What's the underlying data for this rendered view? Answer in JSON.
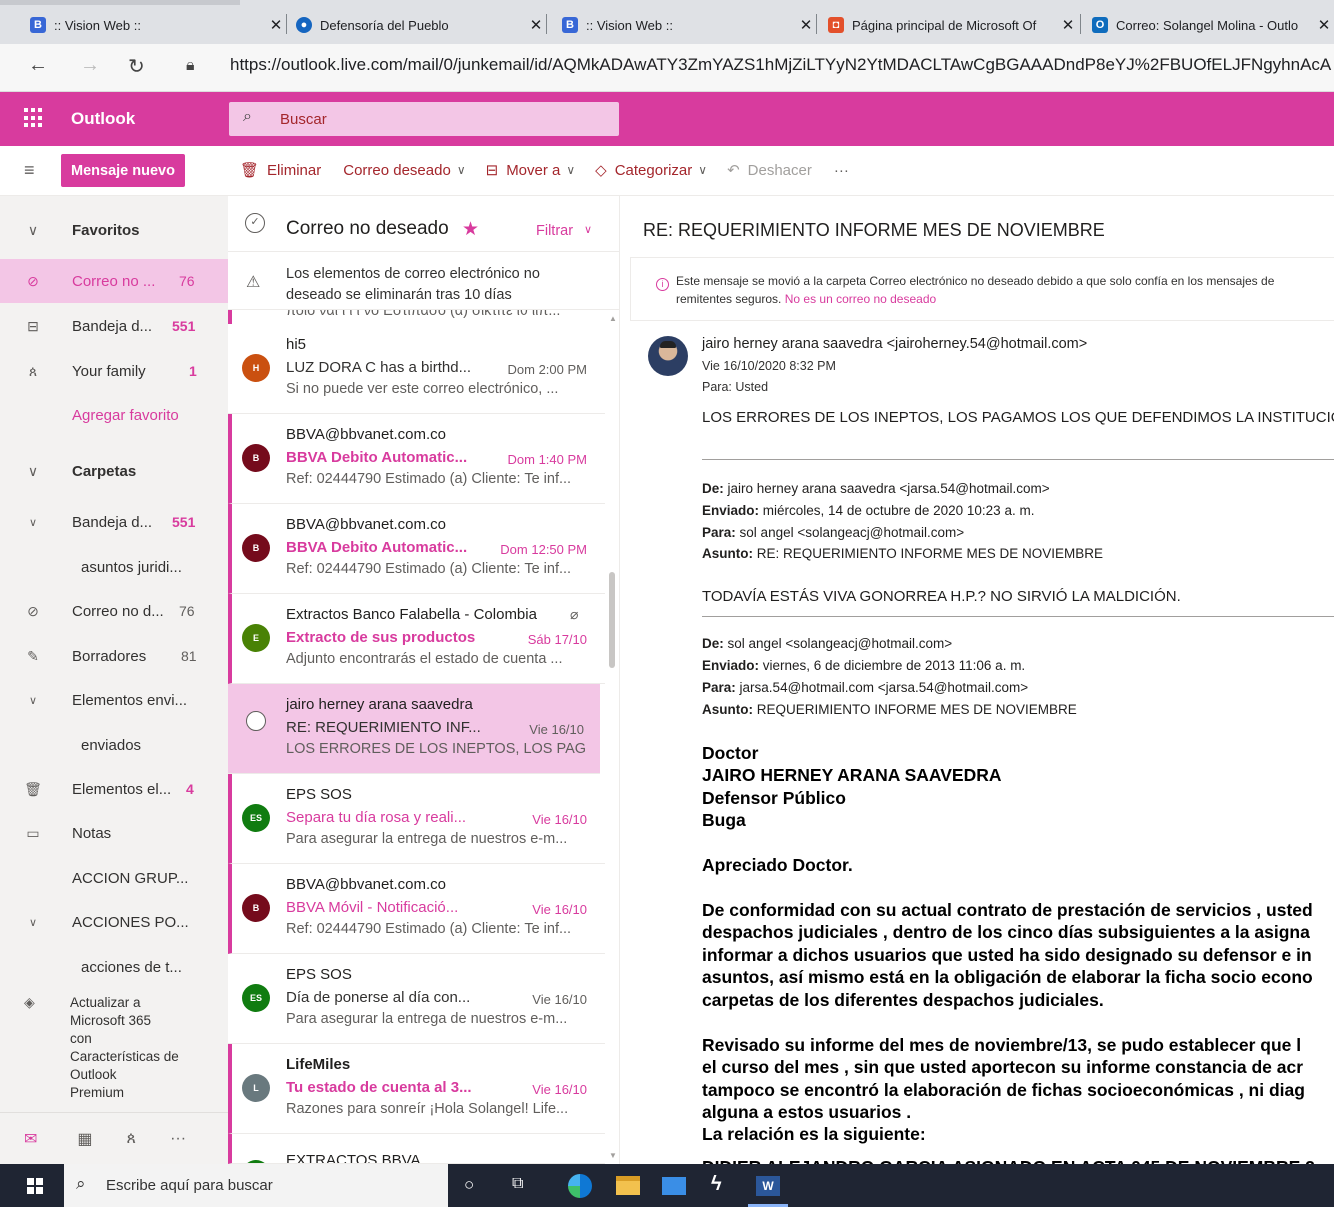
{
  "browser": {
    "tabs": [
      {
        "title": ":: Vision Web ::",
        "icon": "b-icon",
        "color": "#3867d6"
      },
      {
        "title": "Defensoría del Pueblo",
        "icon": "defensoria-icon",
        "color": "#1565c0"
      },
      {
        "title": ":: Vision Web ::",
        "icon": "b-icon",
        "color": "#3867d6"
      },
      {
        "title": "Página principal de Microsoft Of",
        "icon": "office-icon",
        "color": "#e3502b"
      },
      {
        "title": "Correo: Solangel Molina - Outlo",
        "icon": "outlook-icon",
        "color": "#0f6cbd"
      }
    ],
    "url": "https://outlook.live.com/mail/0/junkemail/id/AQMkADAwATY3ZmYAZS1hMjZiLTYyN2YtMDACLTAwCgBGAAADndP8eYJ%2FBUOfELJFNgyhnAcA"
  },
  "app": {
    "name": "Outlook",
    "search_placeholder": "Buscar",
    "brand_color": "#d83b9e"
  },
  "toolbar": {
    "new_message": "Mensaje nuevo",
    "delete": "Eliminar",
    "junk": "Correo deseado",
    "move": "Mover a",
    "categorize": "Categorizar",
    "undo": "Deshacer",
    "more": "···"
  },
  "nav": {
    "favorites_header": "Favoritos",
    "favorites": [
      {
        "label": "Correo no ...",
        "count": "76",
        "icon": "blocked-icon"
      },
      {
        "label": "Bandeja d...",
        "count": "551",
        "icon": "inbox-icon"
      },
      {
        "label": "Your family",
        "count": "1",
        "icon": "people-icon"
      }
    ],
    "add_favorite": "Agregar favorito",
    "folders_header": "Carpetas",
    "folders": [
      {
        "label": "Bandeja d...",
        "count": "551"
      },
      {
        "label": "asuntos juridi...",
        "count": ""
      },
      {
        "label": "Correo no d...",
        "count": "76"
      },
      {
        "label": "Borradores",
        "count": "81"
      },
      {
        "label": "Elementos envi...",
        "count": ""
      },
      {
        "label": "enviados",
        "count": ""
      },
      {
        "label": "Elementos el...",
        "count": "4"
      },
      {
        "label": "Notas",
        "count": ""
      },
      {
        "label": "ACCION GRUP...",
        "count": ""
      },
      {
        "label": "ACCIONES PO...",
        "count": ""
      },
      {
        "label": "acciones de t...",
        "count": ""
      }
    ],
    "upgrade": [
      "Actualizar a",
      "Microsoft 365",
      "con",
      "Características de",
      "Outlook",
      "Premium"
    ]
  },
  "list": {
    "title": "Correo no deseado",
    "filter": "Filtrar",
    "notice": [
      "Los elementos de correo electrónico no",
      "deseado se eliminarán tras 10 días"
    ],
    "partial_top": "ποιο ναι ι ι ι νο Εστιπασο (α) σικτίτε ιθ ιιπ...",
    "messages": [
      {
        "initial": "H",
        "avatar_color": "#ca5010",
        "from": "hi5",
        "subject": "LUZ DORA C has a birthd...",
        "date": "Dom 2:00 PM",
        "preview": "Si no puede ver este correo electrónico, ...",
        "unread": false
      },
      {
        "initial": "B",
        "avatar_color": "#750b1c",
        "from": "BBVA@bbvanet.com.co",
        "subject": "BBVA Debito Automatic...",
        "date": "Dom 1:40 PM",
        "preview": "Ref: 02444790 Estimado (a) Cliente: Te inf...",
        "unread": true
      },
      {
        "initial": "B",
        "avatar_color": "#750b1c",
        "from": "BBVA@bbvanet.com.co",
        "subject": "BBVA Debito Automatic...",
        "date": "Dom 12:50 PM",
        "preview": "Ref: 02444790 Estimado (a) Cliente: Te inf...",
        "unread": true
      },
      {
        "initial": "E",
        "avatar_color": "#498205",
        "from": "Extractos Banco Falabella - Colombia",
        "subject": "Extracto de sus productos",
        "date": "Sáb 17/10",
        "preview": "Adjunto encontrarás el estado de cuenta ...",
        "unread": true
      },
      {
        "initial": "",
        "avatar_color": "",
        "from": "jairo herney arana saavedra",
        "subject": "RE: REQUERIMIENTO INF...",
        "date": "Vie 16/10",
        "preview": "LOS ERRORES DE LOS INEPTOS, LOS PAG...",
        "unread": false
      },
      {
        "initial": "ES",
        "avatar_color": "#107c10",
        "from": "EPS SOS",
        "subject": "Separa tu día rosa y reali...",
        "date": "Vie 16/10",
        "preview": "Para asegurar la entrega de nuestros e-m...",
        "unread": true
      },
      {
        "initial": "B",
        "avatar_color": "#750b1c",
        "from": "BBVA@bbvanet.com.co",
        "subject": "BBVA Móvil - Notificació...",
        "date": "Vie 16/10",
        "preview": "Ref: 02444790 Estimado (a) Cliente: Te inf...",
        "unread": true
      },
      {
        "initial": "ES",
        "avatar_color": "#107c10",
        "from": "EPS SOS",
        "subject": "Día de ponerse al día con...",
        "date": "Vie 16/10",
        "preview": "Para asegurar la entrega de nuestros e-m...",
        "unread": false
      },
      {
        "initial": "L",
        "avatar_color": "#69797e",
        "from": "LifeMiles",
        "subject": "Tu estado de cuenta al 3...",
        "date": "Vie 16/10",
        "preview": "Razones para sonreír ¡Hola Solangel! Life...",
        "unread": true
      },
      {
        "initial": "",
        "avatar_color": "#107c10",
        "from": "EXTRACTOS BBVA",
        "subject": "",
        "date": "",
        "preview": "",
        "unread": true
      }
    ]
  },
  "reading": {
    "subject": "RE: REQUERIMIENTO INFORME MES DE NOVIEMBRE",
    "junk_notice": "Este mensaje se movió a la carpeta Correo electrónico no deseado debido a que solo confía en los mensajes de",
    "junk_notice2": "remitentes seguros.",
    "not_junk": "No es un correo no deseado",
    "sender": "jairo herney arana saavedra <jairoherney.54@hotmail.com>",
    "sent": "Vie 16/10/2020 8:32 PM",
    "to_label": "Para:",
    "to": "Usted",
    "line1": "LOS ERRORES DE LOS INEPTOS,  LOS PAGAMOS LOS QUE DEFENDIMOS LA INSTITUCIÓN.",
    "q1": {
      "de_l": "De:",
      "de": "jairo herney arana saavedra <jarsa.54@hotmail.com>",
      "env_l": "Enviado:",
      "env": "miércoles, 14 de octubre de 2020 10:23 a. m.",
      "para_l": "Para:",
      "para": "sol angel <solangeacj@hotmail.com>",
      "asu_l": "Asunto:",
      "asu": "RE: REQUERIMIENTO INFORME MES DE NOVIEMBRE"
    },
    "line2": "TODAVÍA ESTÁS VIVA GONORREA H.P.? NO SIRVIÓ LA MALDICIÓN.",
    "q2": {
      "de_l": "De:",
      "de": "sol angel <solangeacj@hotmail.com>",
      "env_l": "Enviado:",
      "env": "viernes, 6 de diciembre de 2013 11:06 a. m.",
      "para_l": "Para:",
      "para": "jarsa.54@hotmail.com <jarsa.54@hotmail.com>",
      "asu_l": "Asunto:",
      "asu": "REQUERIMIENTO INFORME MES DE NOVIEMBRE"
    },
    "salutation": [
      "Doctor",
      "JAIRO HERNEY ARANA SAAVEDRA",
      "Defensor Público",
      "Buga"
    ],
    "greeting": "Apreciado Doctor.",
    "para1": [
      "De conformidad con su actual contrato de prestación de servicios , usted",
      "despachos judiciales , dentro de los cinco días subsiguientes a la asigna",
      "informar a dichos usuarios que usted ha sido designado su defensor e in",
      "asuntos, así mismo está en la obligación de elaborar la ficha socio econo",
      "carpetas de los diferentes despachos judiciales."
    ],
    "para2": [
      "Revisado su informe del mes de noviembre/13, se pudo establecer que l",
      "el curso del mes , sin que usted aportecon su informe  constancia de acr",
      "tampoco se encontró la elaboración de fichas socioeconómicas , ni diag",
      "alguna a estos usuarios .",
      "La relación es la siguiente:"
    ],
    "cut_line": "DIDIER ALEJANDRO GARCIA ASIGNADO EN ACTA 045 DE NOVIEMBRE 2"
  },
  "taskbar": {
    "search": "Escribe aquí para buscar"
  }
}
